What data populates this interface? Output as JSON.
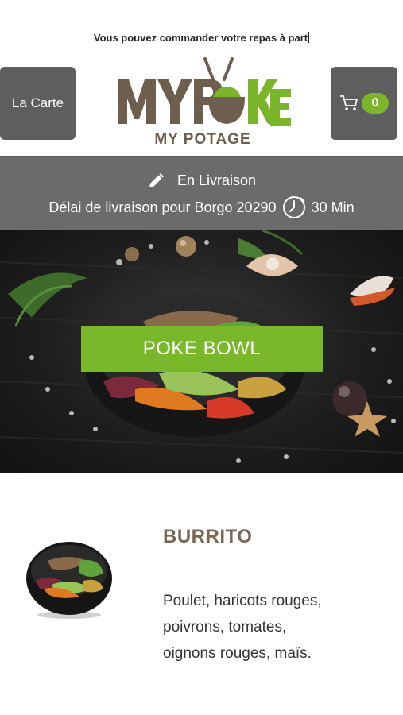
{
  "header": {
    "notice": "Vous pouvez commander votre repas à part",
    "menu_button": "La Carte",
    "cart_count": "0",
    "logo_text": "MYPOKE",
    "logo_sub": "MY POTAGE"
  },
  "delivery": {
    "mode": "En Livraison",
    "delay_text": "Délai de livraison pour Borgo 20290",
    "delay_value": "30 Min"
  },
  "hero": {
    "button_label": "POKE BOWL"
  },
  "product": {
    "title": "BURRITO",
    "description": "Poulet, haricots rouges, poivrons, tomates, oignons rouges, maïs."
  },
  "icons": [
    "cart-icon",
    "pencil-icon",
    "clock-icon"
  ],
  "colors": {
    "accent": "#7ab52a",
    "dark_panel": "#5e5e5e",
    "brown": "#6e5e4e"
  }
}
